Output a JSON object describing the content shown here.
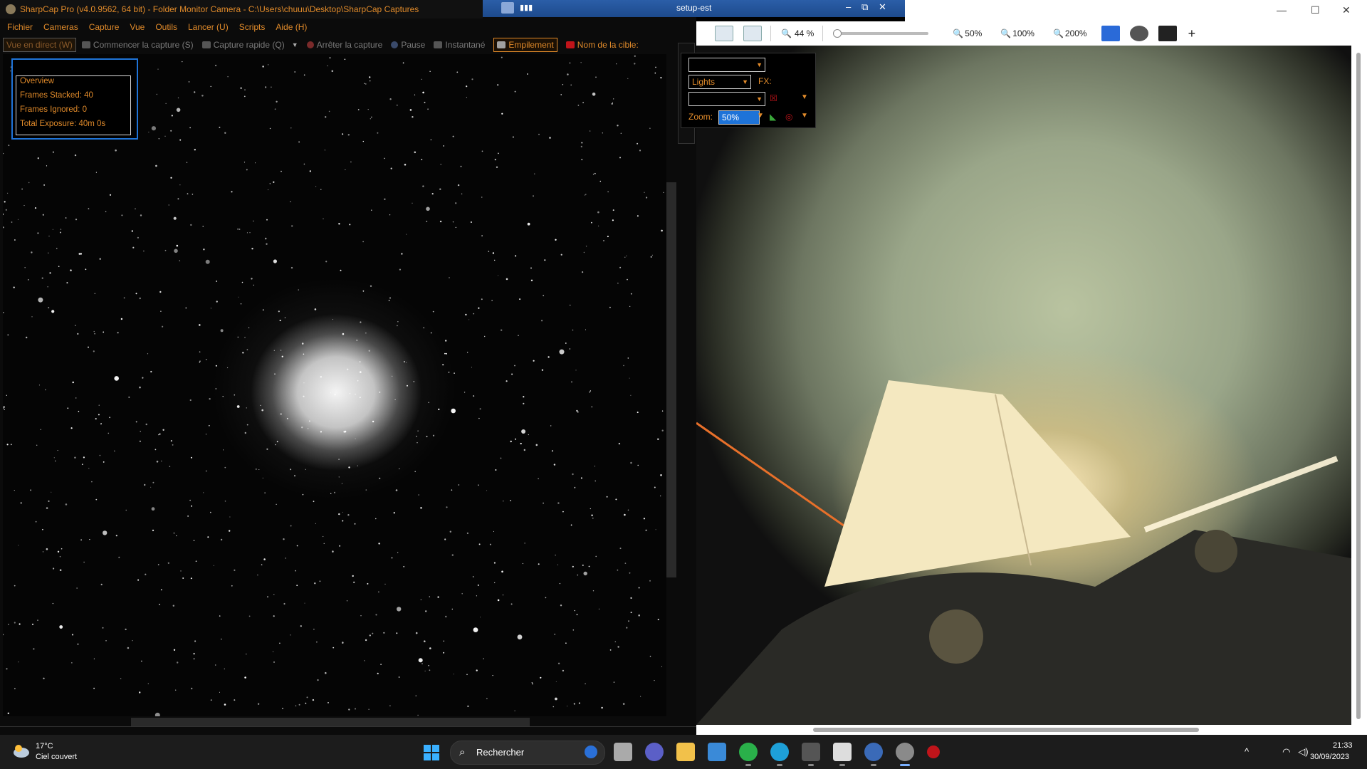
{
  "sharpcap": {
    "title": "SharpCap Pro (v4.0.9562, 64 bit) - Folder Monitor Camera - C:\\Users\\chuuu\\Desktop\\SharpCap Captures",
    "menu": [
      "Fichier",
      "Cameras",
      "Capture",
      "Vue",
      "Outils",
      "Lancer (U)",
      "Scripts",
      "Aide (H)"
    ],
    "toolbar": {
      "live": "Vue en direct (W)",
      "start_capture": "Commencer la capture (S)",
      "quick_capture": "Capture rapide (Q)",
      "stop_capture": "Arrêter la capture",
      "pause": "Pause",
      "snapshot": "Instantané",
      "stacking": "Empilement",
      "target_name": "Nom de la cible:"
    },
    "overview": {
      "title": "Overview",
      "frames_stacked": "Frames Stacked: 40",
      "frames_ignored": "Frames Ignored: 0",
      "total_exposure": "Total Exposure:   40m 0s"
    },
    "stack_panel": {
      "frame_type": "Lights",
      "fx_label": "FX:",
      "zoom_label": "Zoom:",
      "zoom_value": "50%"
    }
  },
  "rdp": {
    "title": "setup-est",
    "minimize": "–",
    "restore": "⧉",
    "close": "✕"
  },
  "viewer": {
    "minimize": "—",
    "maximize": "☐",
    "close": "✕",
    "zoom_current": "44 %",
    "zoom_presets": [
      "50%",
      "100%",
      "200%"
    ],
    "add": "+",
    "icons": [
      "fit-screen-icon",
      "actual-size-icon",
      "zoom-icon",
      "run-icon",
      "settings-icon",
      "terminal-icon"
    ]
  },
  "taskbar": {
    "weather_temp": "17°C",
    "weather_desc": "Ciel couvert",
    "search_placeholder": "Rechercher",
    "apps": [
      "task-view-icon",
      "teams-icon",
      "file-explorer-icon",
      "store-icon",
      "app-green-icon",
      "edge-icon",
      "app-dark-icon",
      "app-pen-icon",
      "app-remote-icon",
      "sharpcap-icon",
      "app-red-icon"
    ],
    "time": "21:33",
    "date": "30/09/2023"
  }
}
